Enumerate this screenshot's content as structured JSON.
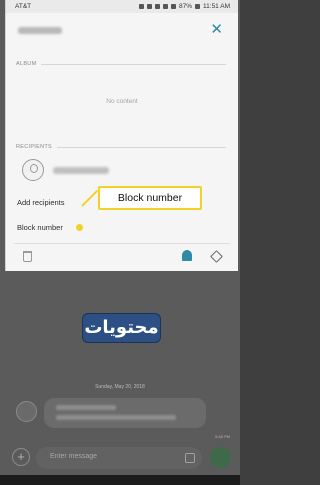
{
  "status_bar": {
    "carrier": "AT&T",
    "battery": "87%",
    "time": "11:51 AM"
  },
  "panel": {
    "close_glyph": "✕",
    "album": {
      "heading": "ALBUM",
      "empty_text": "No content"
    },
    "recipients": {
      "heading": "RECIPIENTS"
    },
    "add_recipients_label": "Add recipients",
    "block_number_label": "Block number",
    "toolbar_icons": [
      "trash-icon",
      "bell-icon",
      "pin-icon"
    ]
  },
  "annotation": {
    "text": "Block number",
    "color": "#f2d228"
  },
  "conversation": {
    "date": "Sunday, May 20, 2018",
    "message_time": "5:46 PM",
    "compose_placeholder": "Enter message",
    "plus_glyph": "+"
  },
  "watermark": {
    "text": "محتويات"
  },
  "colors": {
    "accent": "#2f8aa6",
    "watermark_bg": "#2c4f84"
  }
}
